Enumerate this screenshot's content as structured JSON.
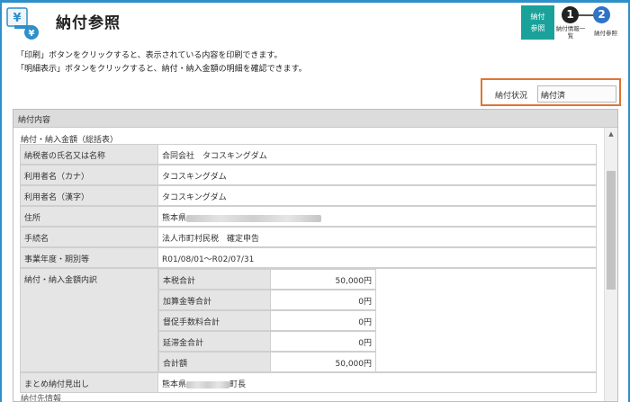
{
  "header": {
    "title": "納付参照",
    "logo_icon": "tax-payment-logo-icon"
  },
  "steps": {
    "active_label": "納付参照",
    "step1_number": "1",
    "step1_label": "納付情報一覧",
    "step2_number": "2",
    "step2_label": "納付参照"
  },
  "instructions": {
    "line1": "「印刷」ボタンをクリックすると、表示されている内容を印刷できます。",
    "line2": "「明細表示」ボタンをクリックすると、納付・納入金額の明細を確認できます。"
  },
  "status": {
    "label": "納付状況",
    "value": "納付済"
  },
  "panel": {
    "header": "納付内容",
    "section_title": "納付・納入金額（総括表）",
    "rows": [
      {
        "label": "納税者の氏名又は名称",
        "value": "合同会社　タコスキングダム"
      },
      {
        "label": "利用者名（カナ）",
        "value": "タコスキングダム"
      },
      {
        "label": "利用者名（漢字）",
        "value": "タコスキングダム"
      },
      {
        "label": "住所",
        "value": "熊本県"
      },
      {
        "label": "手続名",
        "value": "法人市町村民税　確定申告"
      },
      {
        "label": "事業年度・期別等",
        "value": "R01/08/01～R02/07/31"
      }
    ],
    "breakdown": {
      "label": "納付・納入金額内訳",
      "items": [
        {
          "label": "本税合計",
          "value": "50,000円"
        },
        {
          "label": "加算金等合計",
          "value": "0円"
        },
        {
          "label": "督促手数料合計",
          "value": "0円"
        },
        {
          "label": "延滞金合計",
          "value": "0円"
        },
        {
          "label": "合計額",
          "value": "50,000円"
        }
      ]
    },
    "summary_row": {
      "label": "まとめ納付見出し",
      "value_prefix": "熊本県",
      "value_suffix": "町長"
    },
    "next_section": "納付先情報"
  }
}
